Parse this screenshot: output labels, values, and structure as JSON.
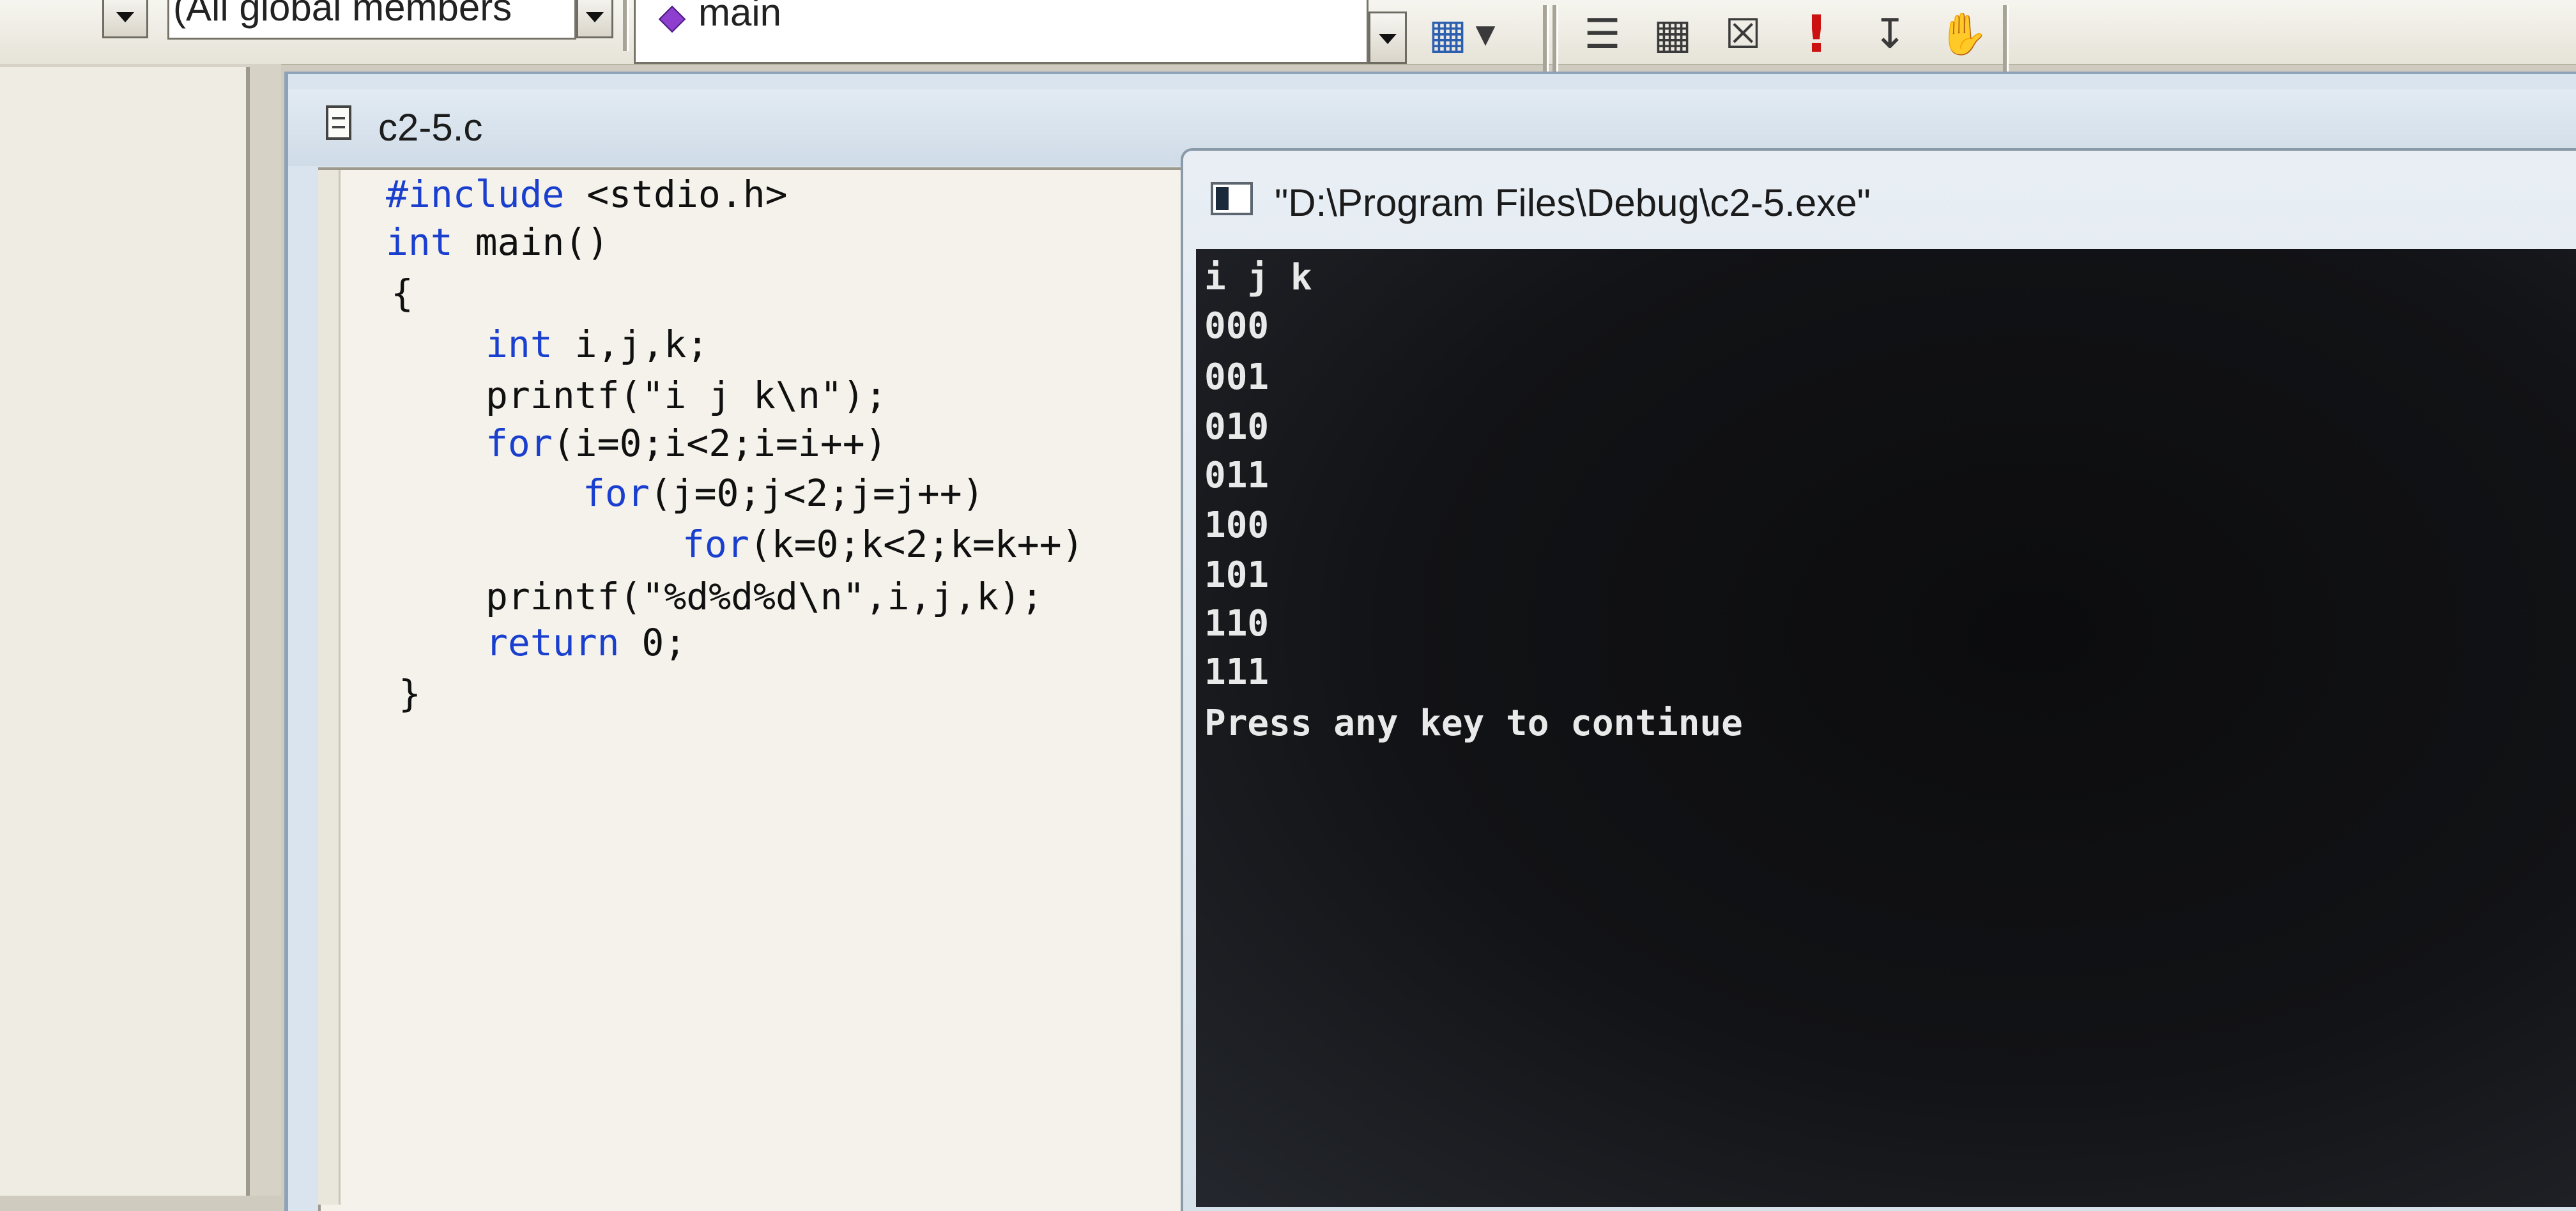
{
  "toolbar": {
    "scope_combo": "(All global members",
    "function_combo": "main",
    "icons": [
      "compile-icon",
      "build-icon",
      "stop-build-icon",
      "execute-icon",
      "go-icon",
      "breakpoint-hand-icon"
    ]
  },
  "document": {
    "tab_title": "c2-5.c",
    "code": [
      {
        "kw": "#include",
        "rest": " <stdio.h>"
      },
      {
        "kw": "int",
        "rest": " main()"
      },
      {
        "kw": "",
        "rest": "{"
      },
      {
        "kw": "int",
        "rest": " i,j,k;"
      },
      {
        "kw": "",
        "rest": "printf(\"i j k\\n\");"
      },
      {
        "kw": "for",
        "rest": "(i=0;i<2;i=i++)"
      },
      {
        "kw": "for",
        "rest": "(j=0;j<2;j=j++)"
      },
      {
        "kw": "for",
        "rest": "(k=0;k<2;k=k++)"
      },
      {
        "kw": "",
        "rest": "printf(\"%d%d%d\\n\",i,j,k);"
      },
      {
        "kw": "return",
        "rest": " 0;"
      },
      {
        "kw": "",
        "rest": "}"
      }
    ]
  },
  "console": {
    "title": "\"D:\\Program Files\\Debug\\c2-5.exe\"",
    "lines": [
      "i j k",
      "000",
      "001",
      "010",
      "011",
      "100",
      "101",
      "110",
      "111",
      "Press any key to continue"
    ]
  }
}
